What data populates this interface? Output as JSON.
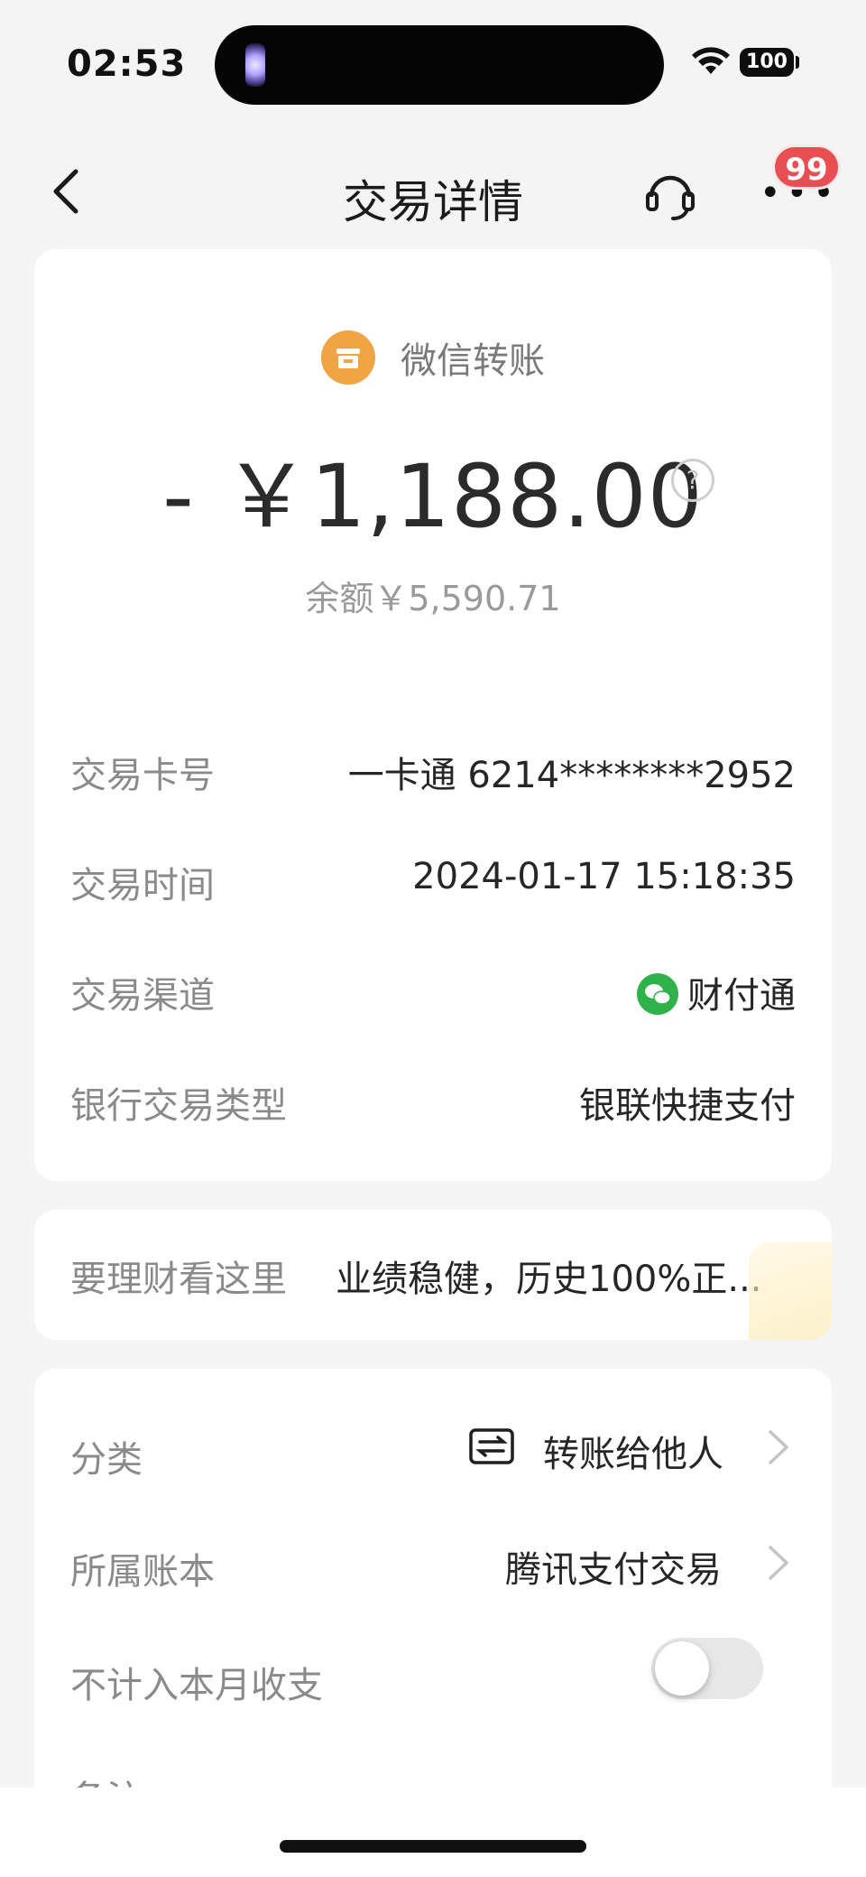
{
  "status_bar": {
    "time": "02:53",
    "battery": "100"
  },
  "nav": {
    "title": "交易详情",
    "badge": "99"
  },
  "summary": {
    "merchant": "微信转账",
    "amount": "- ￥1,188.00",
    "balance": "余额￥5,590.71"
  },
  "details": [
    {
      "label": "交易卡号",
      "value": "一卡通 6214********2952"
    },
    {
      "label": "交易时间",
      "value": "2024-01-17 15:18:35"
    },
    {
      "label": "交易渠道",
      "value": "财付通"
    },
    {
      "label": "银行交易类型",
      "value": "银联快捷支付"
    }
  ],
  "promo": {
    "label": "要理财看这里",
    "text": "业绩稳健，历史100%正..."
  },
  "settings": {
    "category_label": "分类",
    "category_value": "转账给他人",
    "ledger_label": "所属账本",
    "ledger_value": "腾讯支付交易",
    "exclude_label": "不计入本月收支",
    "note_label": "备注"
  },
  "colors": {
    "accent_orange": "#f1a444",
    "wechat_green": "#2fb24a",
    "badge_red": "#e84e52"
  }
}
